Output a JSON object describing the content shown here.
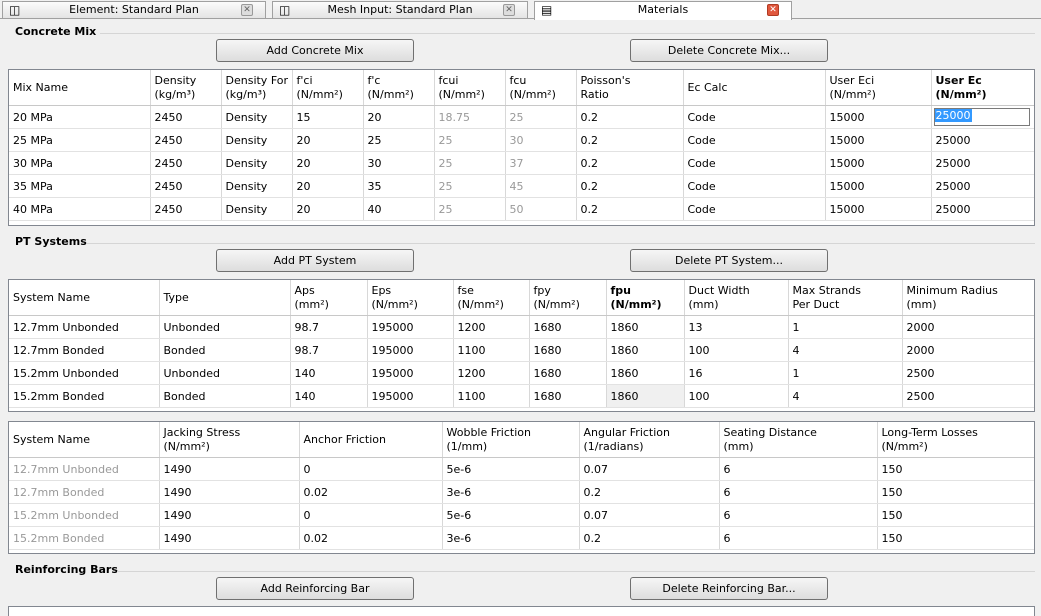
{
  "tabs": [
    {
      "label": "Element: Standard Plan",
      "icon": "plan-icon"
    },
    {
      "label": "Mesh Input: Standard Plan",
      "icon": "plan-icon"
    },
    {
      "label": "Materials",
      "icon": "document-icon"
    }
  ],
  "concrete": {
    "title": "Concrete Mix",
    "add_label": "Add Concrete Mix",
    "delete_label": "Delete Concrete Mix...",
    "columns": [
      {
        "l1": "Mix Name",
        "l2": ""
      },
      {
        "l1": "Density",
        "l2": "(kg/m³)"
      },
      {
        "l1": "Density For",
        "l2": "(kg/m³)"
      },
      {
        "l1": "f'ci",
        "l2": "(N/mm²)"
      },
      {
        "l1": "f'c",
        "l2": "(N/mm²)"
      },
      {
        "l1": "fcui",
        "l2": "(N/mm²)"
      },
      {
        "l1": "fcu",
        "l2": "(N/mm²)"
      },
      {
        "l1": "Poisson's",
        "l2": "Ratio"
      },
      {
        "l1": "Ec Calc",
        "l2": ""
      },
      {
        "l1": "User Eci",
        "l2": "(N/mm²)"
      },
      {
        "l1": "User Ec",
        "l2": "(N/mm²)"
      }
    ],
    "rows": [
      [
        "20 MPa",
        "2450",
        "Density",
        "15",
        "20",
        "18.75",
        "25",
        "0.2",
        "Code",
        "15000",
        "25000"
      ],
      [
        "25 MPa",
        "2450",
        "Density",
        "20",
        "25",
        "25",
        "30",
        "0.2",
        "Code",
        "15000",
        "25000"
      ],
      [
        "30 MPa",
        "2450",
        "Density",
        "20",
        "30",
        "25",
        "37",
        "0.2",
        "Code",
        "15000",
        "25000"
      ],
      [
        "35 MPa",
        "2450",
        "Density",
        "20",
        "35",
        "25",
        "45",
        "0.2",
        "Code",
        "15000",
        "25000"
      ],
      [
        "40 MPa",
        "2450",
        "Density",
        "20",
        "40",
        "25",
        "50",
        "0.2",
        "Code",
        "15000",
        "25000"
      ]
    ]
  },
  "pt": {
    "title": "PT Systems",
    "add_label": "Add PT System",
    "delete_label": "Delete PT System...",
    "columns": [
      {
        "l1": "System Name",
        "l2": ""
      },
      {
        "l1": "Type",
        "l2": ""
      },
      {
        "l1": "Aps",
        "l2": "(mm²)"
      },
      {
        "l1": "Eps",
        "l2": "(N/mm²)"
      },
      {
        "l1": "fse",
        "l2": "(N/mm²)"
      },
      {
        "l1": "fpy",
        "l2": "(N/mm²)"
      },
      {
        "l1": "fpu",
        "l2": "(N/mm²)"
      },
      {
        "l1": "Duct Width",
        "l2": "(mm)"
      },
      {
        "l1": "Max Strands",
        "l2": "Per Duct"
      },
      {
        "l1": "Minimum Radius",
        "l2": "(mm)"
      }
    ],
    "rows": [
      [
        "12.7mm Unbonded",
        "Unbonded",
        "98.7",
        "195000",
        "1200",
        "1680",
        "1860",
        "13",
        "1",
        "2000"
      ],
      [
        "12.7mm Bonded",
        "Bonded",
        "98.7",
        "195000",
        "1100",
        "1680",
        "1860",
        "100",
        "4",
        "2000"
      ],
      [
        "15.2mm Unbonded",
        "Unbonded",
        "140",
        "195000",
        "1200",
        "1680",
        "1860",
        "16",
        "1",
        "2500"
      ],
      [
        "15.2mm Bonded",
        "Bonded",
        "140",
        "195000",
        "1100",
        "1680",
        "1860",
        "100",
        "4",
        "2500"
      ]
    ],
    "columns2": [
      {
        "l1": "System Name",
        "l2": ""
      },
      {
        "l1": "Jacking Stress",
        "l2": "(N/mm²)"
      },
      {
        "l1": "Anchor Friction",
        "l2": ""
      },
      {
        "l1": "Wobble Friction",
        "l2": "(1/mm)"
      },
      {
        "l1": "Angular Friction",
        "l2": "(1/radians)"
      },
      {
        "l1": "Seating Distance",
        "l2": "(mm)"
      },
      {
        "l1": "Long-Term Losses",
        "l2": "(N/mm²)"
      }
    ],
    "rows2": [
      [
        "12.7mm Unbonded",
        "1490",
        "0",
        "5e-6",
        "0.07",
        "6",
        "150"
      ],
      [
        "12.7mm Bonded",
        "1490",
        "0.02",
        "3e-6",
        "0.2",
        "6",
        "150"
      ],
      [
        "15.2mm Unbonded",
        "1490",
        "0",
        "5e-6",
        "0.07",
        "6",
        "150"
      ],
      [
        "15.2mm Bonded",
        "1490",
        "0.02",
        "3e-6",
        "0.2",
        "6",
        "150"
      ]
    ]
  },
  "rebar": {
    "title": "Reinforcing Bars",
    "add_label": "Add Reinforcing Bar",
    "delete_label": "Delete Reinforcing Bar..."
  },
  "colors": {
    "selection": "#3399ff",
    "close_active": "#e0573d",
    "grid_border": "#828790",
    "disabled_text": "#999999"
  }
}
